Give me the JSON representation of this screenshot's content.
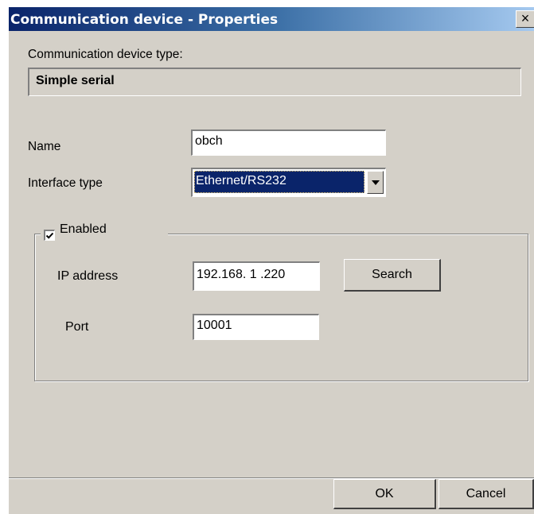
{
  "window": {
    "title": "Communication device - Properties",
    "close_glyph": "×"
  },
  "device_type": {
    "label": "Communication device type:",
    "value": "Simple serial"
  },
  "name": {
    "label": "Name",
    "value": "obch"
  },
  "interface_type": {
    "label": "Interface type",
    "selected": "Ethernet/RS232"
  },
  "enabled": {
    "label": "Enabled",
    "checked": true
  },
  "ip_address": {
    "label": "IP address",
    "value": "192.168.  1  .220"
  },
  "search": {
    "label": "Search"
  },
  "port": {
    "label": "Port",
    "value": "10001"
  },
  "buttons": {
    "ok": "OK",
    "cancel": "Cancel"
  },
  "colors": {
    "title_start": "#0a246a",
    "title_end": "#a6caf0",
    "face": "#d4d0c8",
    "selection": "#0a246a"
  }
}
